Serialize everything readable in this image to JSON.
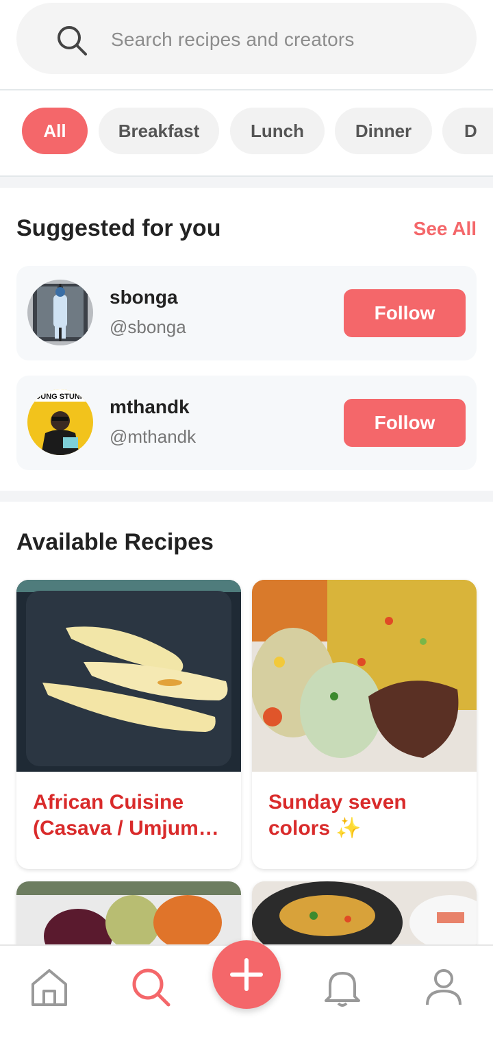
{
  "search": {
    "placeholder": "Search recipes and creators",
    "icon": "search-icon"
  },
  "categories": [
    {
      "label": "All",
      "active": true
    },
    {
      "label": "Breakfast",
      "active": false
    },
    {
      "label": "Lunch",
      "active": false
    },
    {
      "label": "Dinner",
      "active": false
    },
    {
      "label": "D",
      "active": false
    }
  ],
  "suggested": {
    "title": "Suggested for you",
    "see_all": "See All",
    "users": [
      {
        "name": "sbonga",
        "handle": "@sbonga",
        "follow_label": "Follow"
      },
      {
        "name": "mthandk",
        "handle": "@mthandk",
        "follow_label": "Follow",
        "avatar_text": "YOUNG STUNNA"
      }
    ]
  },
  "recipes": {
    "title": "Available Recipes",
    "items": [
      {
        "title_line1": "African Cuisine",
        "title_line2": "(Casava / Umjum…"
      },
      {
        "title_line1": "Sunday seven",
        "title_line2": "colors ✨"
      },
      {
        "title_line1": "",
        "title_line2": ""
      },
      {
        "title_line1": "",
        "title_line2": ""
      }
    ]
  },
  "nav": {
    "items": [
      "home-icon",
      "search-icon",
      "add-icon",
      "bell-icon",
      "profile-icon"
    ],
    "active": "search-icon"
  },
  "colors": {
    "accent": "#f4676a",
    "recipe_title": "#d92b2b",
    "chip_bg": "#f2f2f2"
  }
}
